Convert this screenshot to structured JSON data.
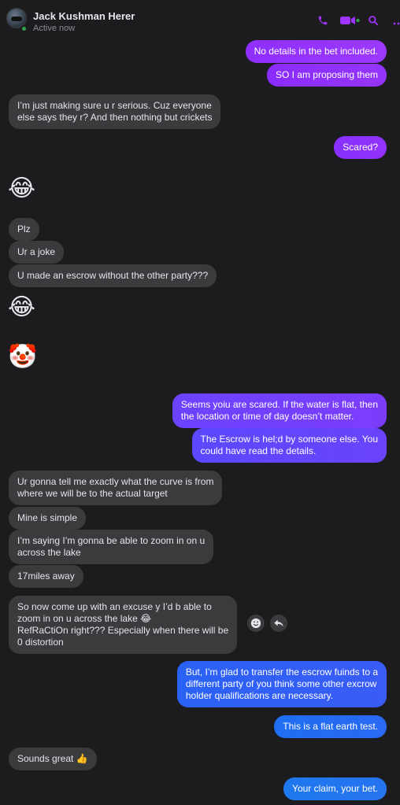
{
  "contact": {
    "name": "Jack Kushman Herer",
    "status": "Active now"
  },
  "header_icons": [
    "phone-icon",
    "video-icon",
    "search-icon",
    "more-icon"
  ],
  "colors": {
    "background": "#1c1c1e",
    "incoming_bubble": "#3a3b3c",
    "accent": "#a033ff",
    "online": "#31a24c"
  },
  "messages": [
    {
      "id": "m1",
      "dir": "out",
      "text": [
        "No details in the bet included."
      ]
    },
    {
      "id": "m2",
      "dir": "out",
      "text": [
        "SO I am proposing them"
      ]
    },
    {
      "id": "m3",
      "dir": "in",
      "text": [
        "I’m just making sure u r serious. Cuz everyone",
        "else says they r? And then nothing but crickets"
      ]
    },
    {
      "id": "m4",
      "dir": "out",
      "text": [
        "Scared?"
      ]
    },
    {
      "id": "m5",
      "dir": "in",
      "emoji": "😂"
    },
    {
      "id": "m6",
      "dir": "in",
      "text": [
        "Plz"
      ]
    },
    {
      "id": "m7",
      "dir": "in",
      "text": [
        "Ur a joke"
      ]
    },
    {
      "id": "m8",
      "dir": "in",
      "text": [
        "U made an escrow without the other party???"
      ]
    },
    {
      "id": "m9",
      "dir": "in",
      "emoji": "😂"
    },
    {
      "id": "m10",
      "dir": "in",
      "emoji": "🤡"
    },
    {
      "id": "m11",
      "dir": "out",
      "text": [
        "Seems yoiu are scared.  If the water is flat, then",
        "the location or time of day doesn’t matter."
      ]
    },
    {
      "id": "m12",
      "dir": "out",
      "text": [
        "The Escrow is hel;d by someone else. You",
        "could have read the details."
      ]
    },
    {
      "id": "m13",
      "dir": "in",
      "text": [
        "Ur gonna tell me exactly what the curve is from",
        "where we will be to the actual target"
      ]
    },
    {
      "id": "m14",
      "dir": "in",
      "text": [
        "Mine is simple"
      ]
    },
    {
      "id": "m15",
      "dir": "in",
      "text": [
        "I’m saying I’m gonna be able to zoom in on u",
        "across the lake"
      ]
    },
    {
      "id": "m16",
      "dir": "in",
      "text": [
        "17miles away"
      ]
    },
    {
      "id": "m17",
      "dir": "in",
      "text": [
        "So now come up with an excuse y I’d b able to",
        "zoom in on u across the lake 😂",
        "RefRaCtiOn right??? Especially when there will be",
        "0 distortion"
      ]
    },
    {
      "id": "m18",
      "dir": "out",
      "text": [
        "But, I’m glad to transfer the escrow fuinds to a",
        "different party of you think some other excrow",
        "holder qualifications are necessary."
      ]
    },
    {
      "id": "m19",
      "dir": "out",
      "text": [
        "This is a flat earth test."
      ]
    },
    {
      "id": "m20",
      "dir": "in",
      "text": [
        "Sounds great 👍"
      ]
    },
    {
      "id": "m21",
      "dir": "out",
      "text": [
        "Your claim, your bet."
      ]
    }
  ],
  "message_actions": [
    "emoji-react-icon",
    "reply-icon"
  ]
}
